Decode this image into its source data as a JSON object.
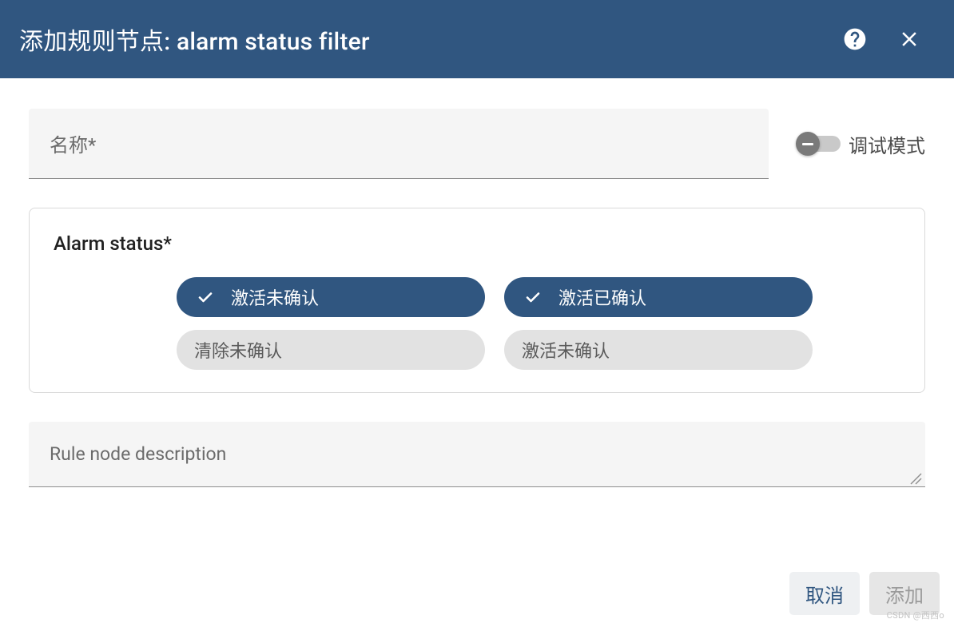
{
  "header": {
    "title": "添加规则节点: alarm status filter"
  },
  "name": {
    "label": "名称*"
  },
  "debug": {
    "label": "调试模式",
    "on": false
  },
  "alarmStatus": {
    "title": "Alarm status*",
    "chips": [
      {
        "label": "激活未确认",
        "selected": true
      },
      {
        "label": "激活已确认",
        "selected": true
      },
      {
        "label": "清除未确认",
        "selected": false
      },
      {
        "label": "激活未确认",
        "selected": false
      }
    ]
  },
  "description": {
    "label": "Rule node description"
  },
  "buttons": {
    "cancel": "取消",
    "add": "添加"
  },
  "watermark": "CSDN @西西o"
}
